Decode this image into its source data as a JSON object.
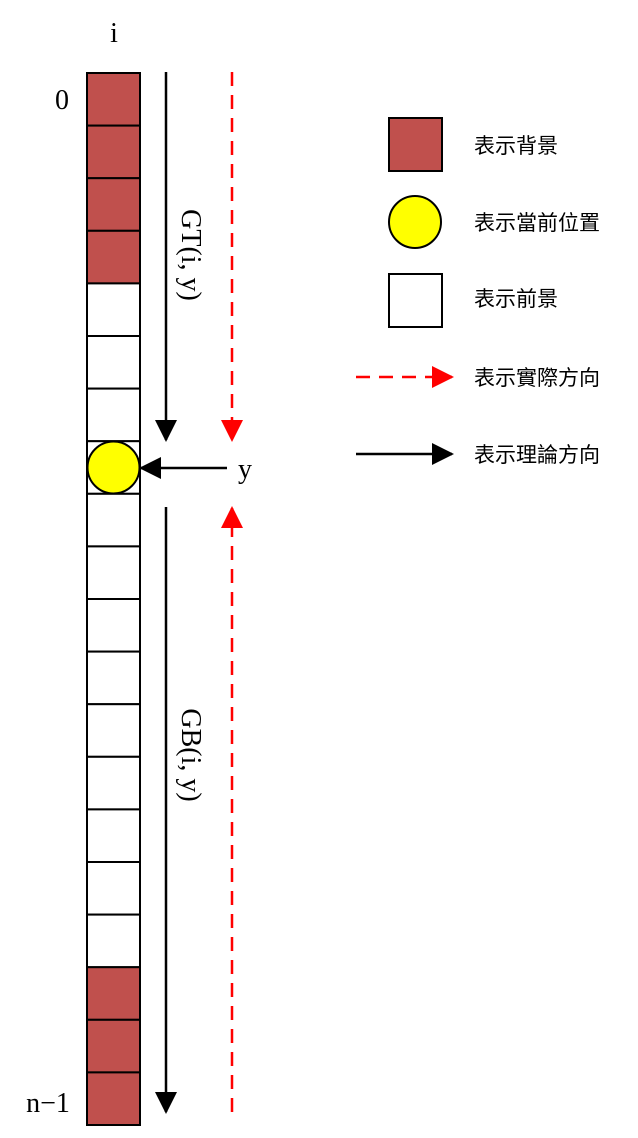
{
  "column_label": "i",
  "row_labels": {
    "top": "0",
    "bottom": "n−1"
  },
  "cells": [
    "background",
    "background",
    "background",
    "background",
    "foreground",
    "foreground",
    "foreground",
    "current",
    "foreground",
    "foreground",
    "foreground",
    "foreground",
    "foreground",
    "foreground",
    "foreground",
    "foreground",
    "foreground",
    "background",
    "background",
    "background"
  ],
  "position_label": "y",
  "gt_label": "GT(i, y)",
  "gb_label": "GB(i, y)",
  "colors": {
    "background": "#c0504d",
    "foreground": "#ffffff",
    "current": "#ffff00",
    "actual_arrow": "#ff0000",
    "theory_arrow": "#000000"
  },
  "legend": {
    "background": "表示背景",
    "current": "表示當前位置",
    "foreground": "表示前景",
    "actual": "表示實際方向",
    "theory": "表示理論方向"
  }
}
